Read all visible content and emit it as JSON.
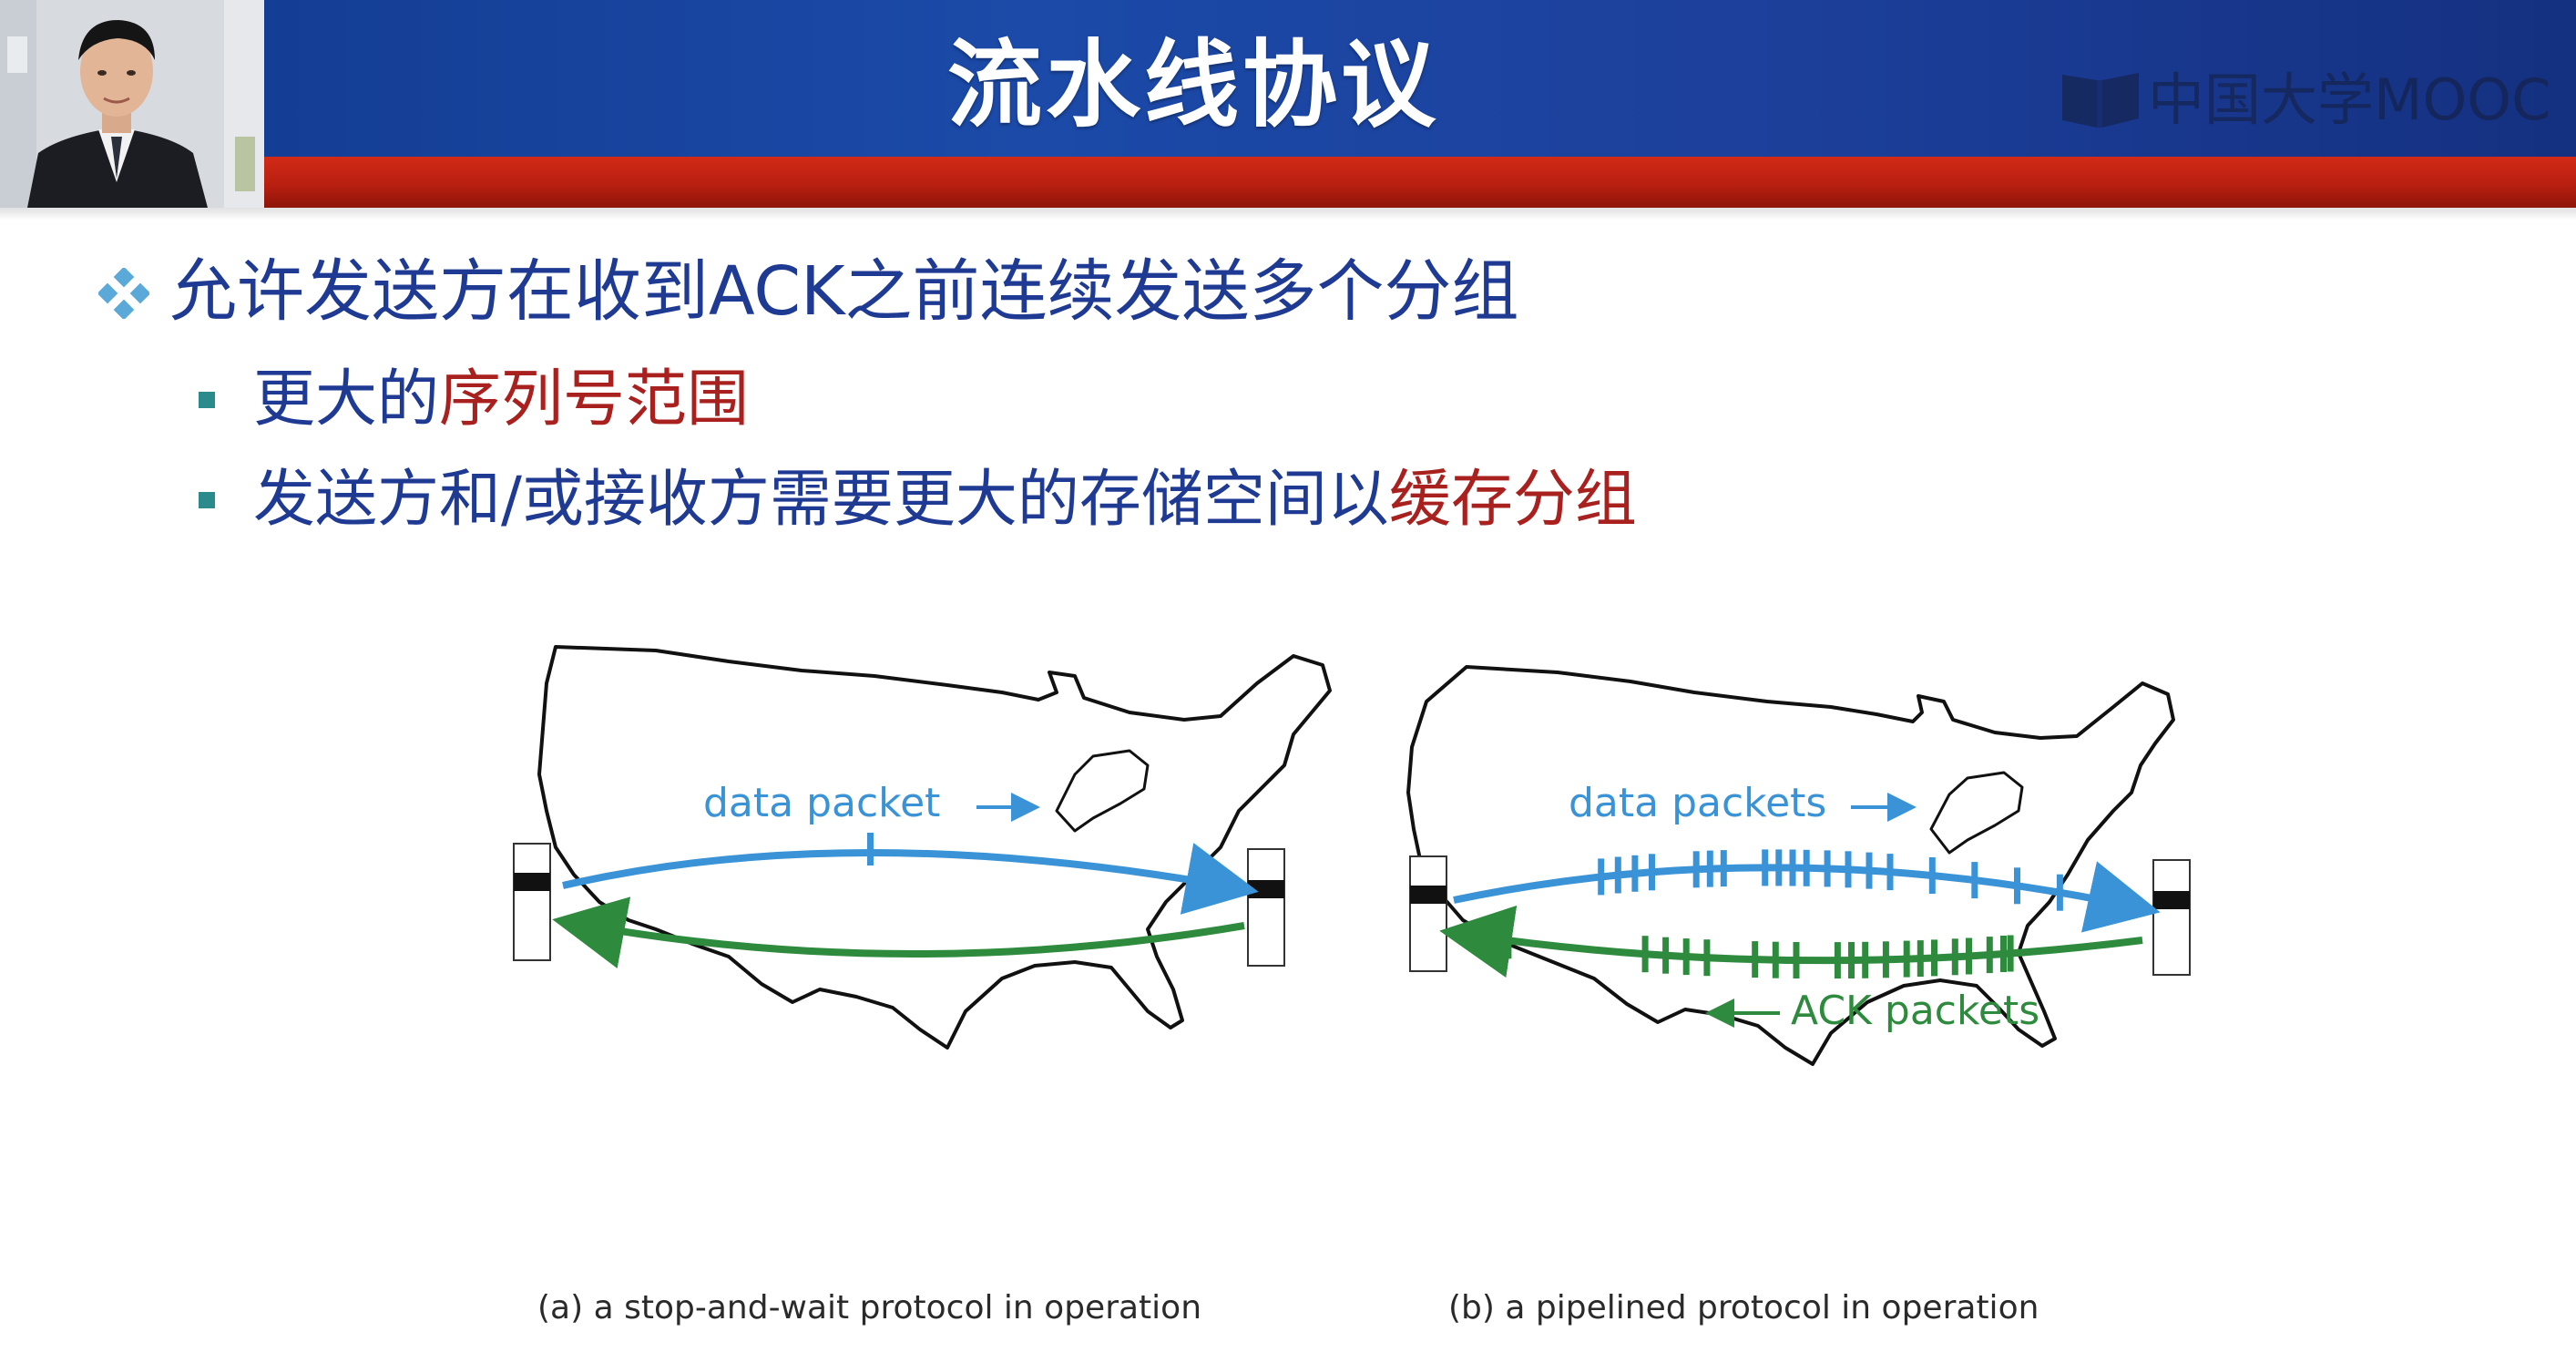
{
  "slide": {
    "title": "流水线协议",
    "logo_text": "中国大学MOOC"
  },
  "bullets": {
    "main": {
      "text_before": "允许发送方在收到",
      "text_ack": "ACK",
      "text_after": "之前连续发送多个分组"
    },
    "sub1": {
      "text_before": "更大的",
      "text_highlight": "序列号范围"
    },
    "sub2": {
      "text_before": "发送方和/或接收方需要更大的存储空间以",
      "text_highlight": "缓存分组"
    }
  },
  "figure": {
    "left_label": "data packet",
    "right_data_label": "data packets",
    "right_ack_label": "ACK packets",
    "caption_a": "(a) a stop-and-wait protocol in operation",
    "caption_b": "(b) a pipelined protocol in operation"
  },
  "colors": {
    "header_blue": "#1b4aa8",
    "header_red": "#c0251a",
    "text_blue": "#1f3a93",
    "highlight_red": "#a8211e",
    "bullet_teal": "#2b8a8c",
    "data_blue": "#3a93d6",
    "ack_green": "#2e8b3e"
  }
}
